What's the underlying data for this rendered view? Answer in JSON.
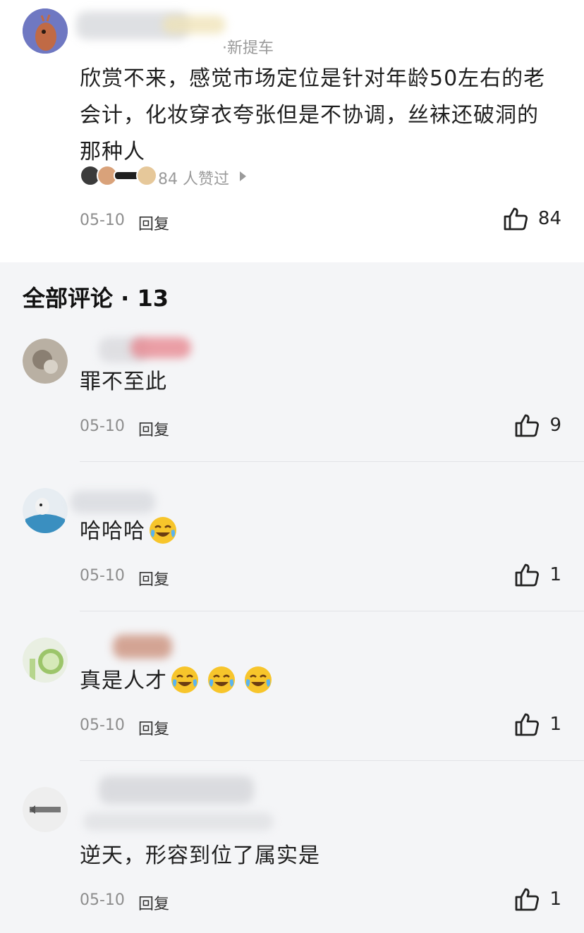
{
  "top_comment": {
    "tag": "新提车",
    "text": "欣赏不来，感觉市场定位是针对年龄50左右的老会计，化妆穿衣夸张但是不协调，丝袜还破洞的那种人",
    "likers_text": "84 人赞过",
    "date": "05-10",
    "reply_label": "回复",
    "like_count": "84"
  },
  "section": {
    "title": "全部评论 · 13"
  },
  "comments": [
    {
      "text": "罪不至此",
      "date": "05-10",
      "reply_label": "回复",
      "like_count": "9",
      "emoji_count": 0
    },
    {
      "text": "哈哈哈",
      "date": "05-10",
      "reply_label": "回复",
      "like_count": "1",
      "emoji_count": 1
    },
    {
      "text": "真是人才",
      "date": "05-10",
      "reply_label": "回复",
      "like_count": "1",
      "emoji_count": 3
    },
    {
      "text": "逆天，形容到位了属实是",
      "date": "05-10",
      "reply_label": "回复",
      "like_count": "1",
      "emoji_count": 0
    }
  ],
  "icons": {
    "like": "thumbs-up-icon",
    "emoji": "laughing-crying-emoji-icon",
    "arrow": "triangle-right-icon"
  },
  "colors": {
    "background": "#f4f5f7",
    "card": "#ffffff",
    "text": "#1f1f1f",
    "meta": "#8d8d8d",
    "emoji_yellow": "#f7c52b"
  }
}
